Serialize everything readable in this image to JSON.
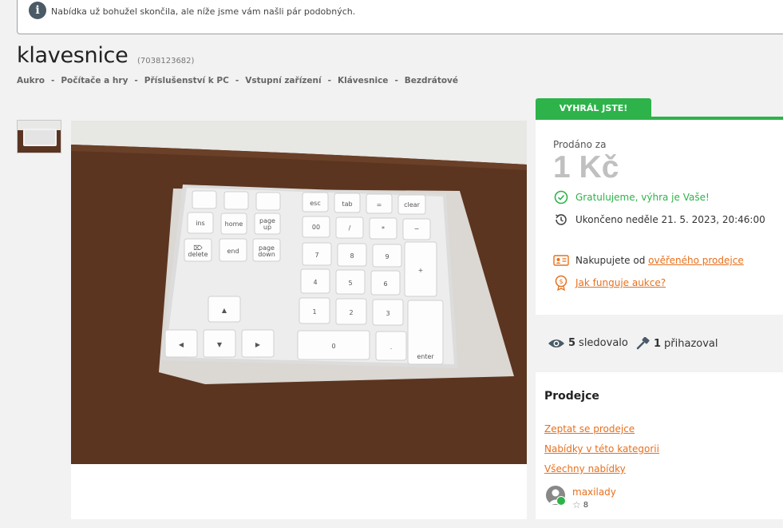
{
  "notice": {
    "message": "Nabídka už bohužel skončila, ale níže jsme vám našli pár podobných."
  },
  "item": {
    "title": "klavesnice",
    "id": "(7038123682)"
  },
  "breadcrumb": [
    "Aukro",
    "Počítače a hry",
    "Příslušenství k PC",
    "Vstupní zařízení",
    "Klávesnice",
    "Bezdrátové"
  ],
  "sold_panel": {
    "tab_label": "VYHRÁL JSTE!",
    "sold_label": "Prodáno za",
    "price": "1 Kč",
    "congrats": "Gratulujeme, výhra je Vaše!",
    "ended": "Ukončeno neděle 21. 5. 2023, 20:46:00",
    "verified_prefix": "Nakupujete od ",
    "verified_link": "ověřeného prodejce",
    "how_link": "Jak funguje aukce?"
  },
  "stats": {
    "watchers_count": "5",
    "watchers_label": "sledovalo",
    "bidders_count": "1",
    "bidders_label": "přihazoval"
  },
  "seller": {
    "heading": "Prodejce",
    "links": [
      "Zeptat se prodejce",
      "Nabídky v této kategorii",
      "Všechny nabídky"
    ],
    "name": "maxilady",
    "rating": "8"
  },
  "colors": {
    "accent_green": "#2db34a",
    "link_orange": "#e8701c",
    "price_grey": "#c0c0c0"
  }
}
